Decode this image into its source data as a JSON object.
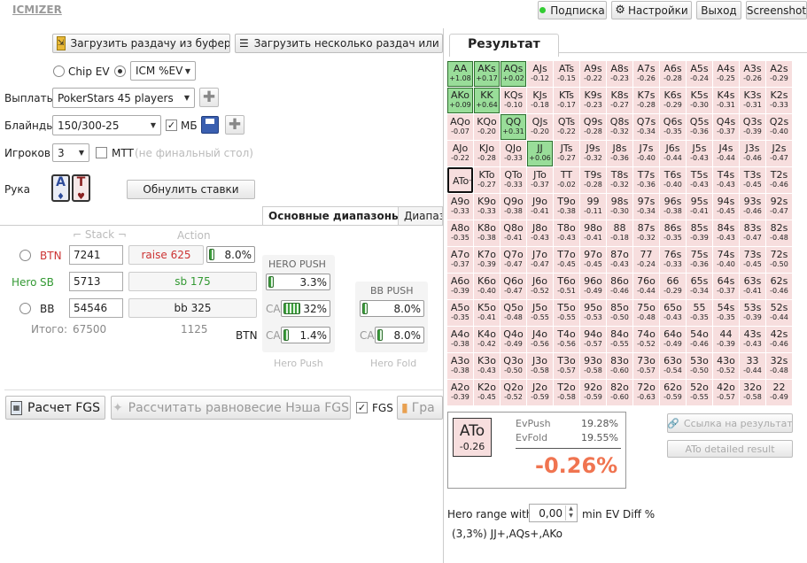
{
  "app": {
    "logo": "ICMIZER"
  },
  "top": {
    "subscription": "Подписка",
    "settings": "Настройки",
    "logout": "Выход",
    "screenshot": "Screenshot"
  },
  "load": {
    "clipboard": "Загрузить раздачу из буфера",
    "multi": "Загрузить несколько раздач или тур"
  },
  "model": {
    "chip": "Chip EV",
    "icm": "ICM %EV"
  },
  "payouts": {
    "label": "Выплаты",
    "value": "PokerStars 45 players"
  },
  "blinds": {
    "label": "Блайнды",
    "value": "150/300-25",
    "mb": "МБ"
  },
  "players": {
    "label": "Игроков",
    "value": "3",
    "mtt": "МТТ",
    "final": "(не финальный стол)"
  },
  "hand": {
    "label": "Рука",
    "c1": "A",
    "c2": "T",
    "reset": "Обнулить ставки"
  },
  "tabs": {
    "main": "Основные диапазоны",
    "second": "Диапаз"
  },
  "cols": {
    "stack": "Stack",
    "action": "Action"
  },
  "seats": [
    {
      "pos": "BTN",
      "stack": "7241",
      "action": "raise 625",
      "pct": "8.0%"
    },
    {
      "hero": "Hero",
      "pos": "SB",
      "stack": "5713",
      "action": "sb 175"
    },
    {
      "pos": "BB",
      "stack": "54546",
      "action": "bb 325"
    }
  ],
  "totals": {
    "label": "Итого:",
    "stack": "67500",
    "action": "1125"
  },
  "heroPush": {
    "title": "HERO PUSH",
    "v1": "3.3%",
    "ca": "CA",
    "v2": "32%",
    "v3": "1.4%",
    "bottom": "Hero Push",
    "btn": "BTN"
  },
  "bbPush": {
    "title": "BB PUSH",
    "v1": "8.0%",
    "ca": "CA",
    "v2": "8.0%",
    "bottom": "Hero Fold"
  },
  "bottom": {
    "fgs": "Расчет FGS",
    "nash": "Рассчитать равновесие Нэша FGS",
    "fgsChk": "FGS",
    "graph": "Гра"
  },
  "result": {
    "title": "Результат",
    "grid": [
      [
        [
          "AA",
          "+1.08",
          1
        ],
        [
          "AKs",
          "+0.17",
          1
        ],
        [
          "AQs",
          "+0.02",
          1
        ],
        [
          "AJs",
          "-0.12"
        ],
        [
          "ATs",
          "-0.15"
        ],
        [
          "A9s",
          "-0.22"
        ],
        [
          "A8s",
          "-0.23"
        ],
        [
          "A7s",
          "-0.26"
        ],
        [
          "A6s",
          "-0.28"
        ],
        [
          "A5s",
          "-0.24"
        ],
        [
          "A4s",
          "-0.25"
        ],
        [
          "A3s",
          "-0.26"
        ],
        [
          "A2s",
          "-0.29"
        ]
      ],
      [
        [
          "AKo",
          "+0.09",
          1
        ],
        [
          "KK",
          "+0.64",
          1
        ],
        [
          "KQs",
          "-0.10"
        ],
        [
          "KJs",
          "-0.18"
        ],
        [
          "KTs",
          "-0.17"
        ],
        [
          "K9s",
          "-0.23"
        ],
        [
          "K8s",
          "-0.27"
        ],
        [
          "K7s",
          "-0.28"
        ],
        [
          "K6s",
          "-0.29"
        ],
        [
          "K5s",
          "-0.30"
        ],
        [
          "K4s",
          "-0.31"
        ],
        [
          "K3s",
          "-0.31"
        ],
        [
          "K2s",
          "-0.33"
        ]
      ],
      [
        [
          "AQo",
          "-0.07"
        ],
        [
          "KQo",
          "-0.20"
        ],
        [
          "QQ",
          "+0.31",
          1
        ],
        [
          "QJs",
          "-0.20"
        ],
        [
          "QTs",
          "-0.22"
        ],
        [
          "Q9s",
          "-0.28"
        ],
        [
          "Q8s",
          "-0.32"
        ],
        [
          "Q7s",
          "-0.34"
        ],
        [
          "Q6s",
          "-0.35"
        ],
        [
          "Q5s",
          "-0.36"
        ],
        [
          "Q4s",
          "-0.37"
        ],
        [
          "Q3s",
          "-0.39"
        ],
        [
          "Q2s",
          "-0.40"
        ]
      ],
      [
        [
          "AJo",
          "-0.22"
        ],
        [
          "KJo",
          "-0.28"
        ],
        [
          "QJo",
          "-0.33"
        ],
        [
          "JJ",
          "+0.06",
          1
        ],
        [
          "JTs",
          "-0.27"
        ],
        [
          "J9s",
          "-0.32"
        ],
        [
          "J8s",
          "-0.36"
        ],
        [
          "J7s",
          "-0.40"
        ],
        [
          "J6s",
          "-0.44"
        ],
        [
          "J5s",
          "-0.43"
        ],
        [
          "J4s",
          "-0.44"
        ],
        [
          "J3s",
          "-0.46"
        ],
        [
          "J2s",
          "-0.47"
        ]
      ],
      [
        [
          "ATo",
          "-0.26",
          2
        ],
        [
          "KTo",
          "-0.27"
        ],
        [
          "QTo",
          "-0.33"
        ],
        [
          "JTo",
          "-0.37"
        ],
        [
          "TT",
          "-0.02"
        ],
        [
          "T9s",
          "-0.28"
        ],
        [
          "T8s",
          "-0.32"
        ],
        [
          "T7s",
          "-0.36"
        ],
        [
          "T6s",
          "-0.40"
        ],
        [
          "T5s",
          "-0.43"
        ],
        [
          "T4s",
          "-0.43"
        ],
        [
          "T3s",
          "-0.45"
        ],
        [
          "T2s",
          "-0.46"
        ]
      ],
      [
        [
          "A9o",
          "-0.33"
        ],
        [
          "K9o",
          "-0.33"
        ],
        [
          "Q9o",
          "-0.38"
        ],
        [
          "J9o",
          "-0.41"
        ],
        [
          "T9o",
          "-0.38"
        ],
        [
          "99",
          "-0.11"
        ],
        [
          "98s",
          "-0.30"
        ],
        [
          "97s",
          "-0.34"
        ],
        [
          "96s",
          "-0.38"
        ],
        [
          "95s",
          "-0.41"
        ],
        [
          "94s",
          "-0.45"
        ],
        [
          "93s",
          "-0.46"
        ],
        [
          "92s",
          "-0.47"
        ]
      ],
      [
        [
          "A8o",
          "-0.35"
        ],
        [
          "K8o",
          "-0.38"
        ],
        [
          "Q8o",
          "-0.41"
        ],
        [
          "J8o",
          "-0.43"
        ],
        [
          "T8o",
          "-0.43"
        ],
        [
          "98o",
          "-0.41"
        ],
        [
          "88",
          "-0.18"
        ],
        [
          "87s",
          "-0.32"
        ],
        [
          "86s",
          "-0.35"
        ],
        [
          "85s",
          "-0.39"
        ],
        [
          "84s",
          "-0.43"
        ],
        [
          "83s",
          "-0.47"
        ],
        [
          "82s",
          "-0.48"
        ]
      ],
      [
        [
          "A7o",
          "-0.37"
        ],
        [
          "K7o",
          "-0.39"
        ],
        [
          "Q7o",
          "-0.47"
        ],
        [
          "J7o",
          "-0.47"
        ],
        [
          "T7o",
          "-0.45"
        ],
        [
          "97o",
          "-0.45"
        ],
        [
          "87o",
          "-0.43"
        ],
        [
          "77",
          "-0.24"
        ],
        [
          "76s",
          "-0.33"
        ],
        [
          "75s",
          "-0.36"
        ],
        [
          "74s",
          "-0.40"
        ],
        [
          "73s",
          "-0.45"
        ],
        [
          "72s",
          "-0.50"
        ]
      ],
      [
        [
          "A6o",
          "-0.39"
        ],
        [
          "K6o",
          "-0.40"
        ],
        [
          "Q6o",
          "-0.47"
        ],
        [
          "J6o",
          "-0.52"
        ],
        [
          "T6o",
          "-0.51"
        ],
        [
          "96o",
          "-0.49"
        ],
        [
          "86o",
          "-0.46"
        ],
        [
          "76o",
          "-0.44"
        ],
        [
          "66",
          "-0.29"
        ],
        [
          "65s",
          "-0.34"
        ],
        [
          "64s",
          "-0.37"
        ],
        [
          "63s",
          "-0.41"
        ],
        [
          "62s",
          "-0.46"
        ]
      ],
      [
        [
          "A5o",
          "-0.35"
        ],
        [
          "K5o",
          "-0.41"
        ],
        [
          "Q5o",
          "-0.48"
        ],
        [
          "J5o",
          "-0.55"
        ],
        [
          "T5o",
          "-0.55"
        ],
        [
          "95o",
          "-0.53"
        ],
        [
          "85o",
          "-0.50"
        ],
        [
          "75o",
          "-0.48"
        ],
        [
          "65o",
          "-0.43"
        ],
        [
          "55",
          "-0.35"
        ],
        [
          "54s",
          "-0.35"
        ],
        [
          "53s",
          "-0.39"
        ],
        [
          "52s",
          "-0.44"
        ]
      ],
      [
        [
          "A4o",
          "-0.38"
        ],
        [
          "K4o",
          "-0.42"
        ],
        [
          "Q4o",
          "-0.49"
        ],
        [
          "J4o",
          "-0.56"
        ],
        [
          "T4o",
          "-0.56"
        ],
        [
          "94o",
          "-0.57"
        ],
        [
          "84o",
          "-0.55"
        ],
        [
          "74o",
          "-0.52"
        ],
        [
          "64o",
          "-0.49"
        ],
        [
          "54o",
          "-0.46"
        ],
        [
          "44",
          "-0.39"
        ],
        [
          "43s",
          "-0.43"
        ],
        [
          "42s",
          "-0.46"
        ]
      ],
      [
        [
          "A3o",
          "-0.38"
        ],
        [
          "K3o",
          "-0.43"
        ],
        [
          "Q3o",
          "-0.50"
        ],
        [
          "J3o",
          "-0.58"
        ],
        [
          "T3o",
          "-0.57"
        ],
        [
          "93o",
          "-0.58"
        ],
        [
          "83o",
          "-0.60"
        ],
        [
          "73o",
          "-0.57"
        ],
        [
          "63o",
          "-0.54"
        ],
        [
          "53o",
          "-0.50"
        ],
        [
          "43o",
          "-0.52"
        ],
        [
          "33",
          "-0.44"
        ],
        [
          "32s",
          "-0.48"
        ]
      ],
      [
        [
          "A2o",
          "-0.39"
        ],
        [
          "K2o",
          "-0.45"
        ],
        [
          "Q2o",
          "-0.52"
        ],
        [
          "J2o",
          "-0.59"
        ],
        [
          "T2o",
          "-0.58"
        ],
        [
          "92o",
          "-0.59"
        ],
        [
          "82o",
          "-0.60"
        ],
        [
          "72o",
          "-0.63"
        ],
        [
          "62o",
          "-0.59"
        ],
        [
          "52o",
          "-0.55"
        ],
        [
          "42o",
          "-0.57"
        ],
        [
          "32o",
          "-0.58"
        ],
        [
          "22",
          "-0.49"
        ]
      ]
    ],
    "hand": "ATo",
    "handEv": "-0.26",
    "evPushLabel": "EvPush",
    "evPush": "19.28%",
    "evFoldLabel": "EvFold",
    "evFold": "19.55%",
    "diff": "-0.26%",
    "link": "Ссылка на результат",
    "detailed": "ATo detailed result",
    "rangeLabel": "Hero range with",
    "rangeVal": "0,00",
    "rangeUnit": "min EV Diff %",
    "rangeText": "(3,3%) JJ+,AQs+,AKo"
  }
}
